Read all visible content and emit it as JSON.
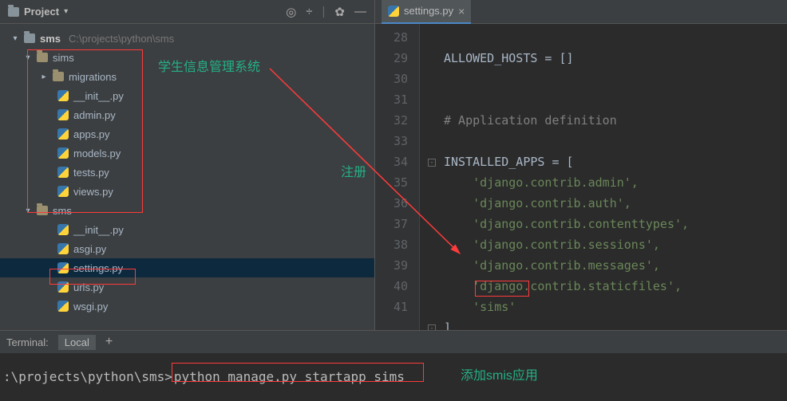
{
  "sidebar": {
    "title": "Project",
    "root": {
      "name": "sms",
      "path": "C:\\projects\\python\\sms"
    },
    "sims": {
      "name": "sims",
      "migrations": "migrations",
      "files": [
        "__init__.py",
        "admin.py",
        "apps.py",
        "models.py",
        "tests.py",
        "views.py"
      ]
    },
    "smsInner": {
      "name": "sms",
      "files": [
        "__init__.py",
        "asgi.py",
        "settings.py",
        "urls.py",
        "wsgi.py"
      ]
    }
  },
  "editor": {
    "tab": "settings.py",
    "gutter_start": 28,
    "gutter_end": 41,
    "line28_partial": "ALLOWED_HOSTS = []",
    "comment": "# Application definition",
    "installed_apps_open": "INSTALLED_APPS = [",
    "apps": [
      "'django.contrib.admin',",
      "'django.contrib.auth',",
      "'django.contrib.contenttypes',",
      "'django.contrib.sessions',",
      "'django.contrib.messages',",
      "'django.contrib.staticfiles',",
      "'sims'"
    ],
    "close_bracket": "]"
  },
  "terminal": {
    "label": "Terminal:",
    "tab": "Local",
    "prompt": ":\\projects\\python\\sms>",
    "command": "python manage.py startapp sims"
  },
  "annotations": {
    "a1": "学生信息管理系统",
    "a2": "注册",
    "a3": "添加smis应用"
  }
}
